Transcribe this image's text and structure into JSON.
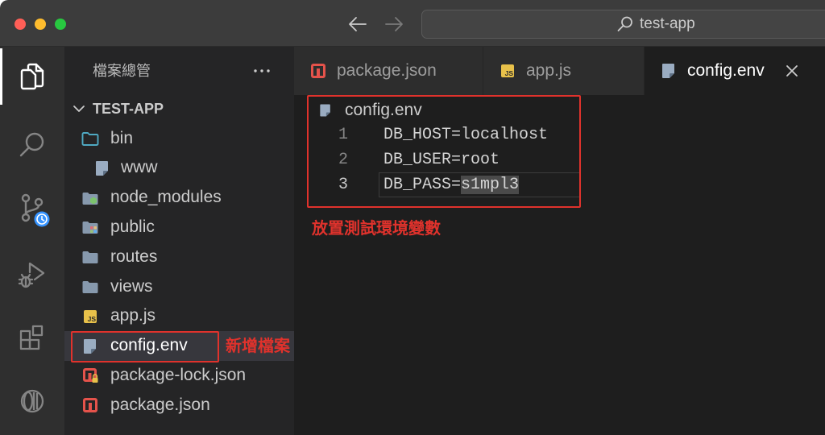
{
  "theme": {
    "titlebar_bg": "#3c3c3c",
    "activitybar_bg": "#2f2f2f",
    "sidebar_bg": "#252526",
    "editor_bg": "#1e1e1e",
    "tab_inactive_bg": "#2d2d2d",
    "selected_row_bg": "#37373d",
    "selection_bg": "#4a4a4a",
    "annotation_red": "#e0322c",
    "badge_blue": "#3794ff",
    "folder": "#8799ad",
    "bin_folder": "#4fa9c2",
    "npm_red": "#e5534b",
    "js_yellow": "#e8c14a",
    "env_file": "#9aacc1",
    "node_green": "#7cc36e"
  },
  "titlebar": {
    "traffic_lights": {
      "close": "#ff5f57",
      "minimize": "#febc2e",
      "zoom": "#28c840"
    },
    "back_icon": "arrow-left-icon",
    "forward_icon": "arrow-right-icon",
    "search": {
      "icon": "search-icon",
      "text": "test-app"
    }
  },
  "activity_bar": {
    "items": [
      {
        "icon": "files-icon",
        "active": true
      },
      {
        "icon": "search-icon"
      },
      {
        "icon": "source-control-icon",
        "badge_icon": "clock-icon"
      },
      {
        "icon": "run-debug-icon"
      },
      {
        "icon": "extensions-icon"
      },
      {
        "icon": "gitlens-icon"
      }
    ]
  },
  "sidebar": {
    "title": "檔案總管",
    "more_icon": "more-actions-icon",
    "project": {
      "name": "TEST-APP",
      "expanded": true,
      "items": [
        {
          "label": "bin",
          "icon": "folder-outline-icon",
          "expanded": true,
          "children": [
            {
              "label": "www",
              "icon": "file-icon"
            }
          ]
        },
        {
          "label": "node_modules",
          "icon": "folder-node-icon"
        },
        {
          "label": "public",
          "icon": "folder-public-icon"
        },
        {
          "label": "routes",
          "icon": "folder-icon"
        },
        {
          "label": "views",
          "icon": "folder-icon"
        },
        {
          "label": "app.js",
          "icon": "js-file-icon"
        },
        {
          "label": "config.env",
          "icon": "env-file-icon",
          "selected": true
        },
        {
          "label": "package-lock.json",
          "icon": "npm-lock-icon"
        },
        {
          "label": "package.json",
          "icon": "npm-icon"
        }
      ]
    }
  },
  "icons": {
    "js_badge_text": "JS"
  },
  "editor": {
    "tabs": [
      {
        "label": "package.json",
        "icon": "npm-icon",
        "active": false
      },
      {
        "label": "app.js",
        "icon": "js-file-icon",
        "active": false
      },
      {
        "label": "config.env",
        "icon": "env-file-icon",
        "active": true,
        "close_icon": "close-icon"
      }
    ],
    "breadcrumb": {
      "icon": "env-file-icon",
      "label": "config.env"
    },
    "lines": [
      {
        "number": 1,
        "text": "DB_HOST=localhost"
      },
      {
        "number": 2,
        "text": "DB_USER=root"
      },
      {
        "number": 3,
        "text": "DB_PASS=",
        "selected_text": "s1mpl3"
      }
    ],
    "active_line": 3
  },
  "annotations": {
    "editor_note": "放置測試環境變數",
    "sidebar_note": "新增檔案"
  }
}
